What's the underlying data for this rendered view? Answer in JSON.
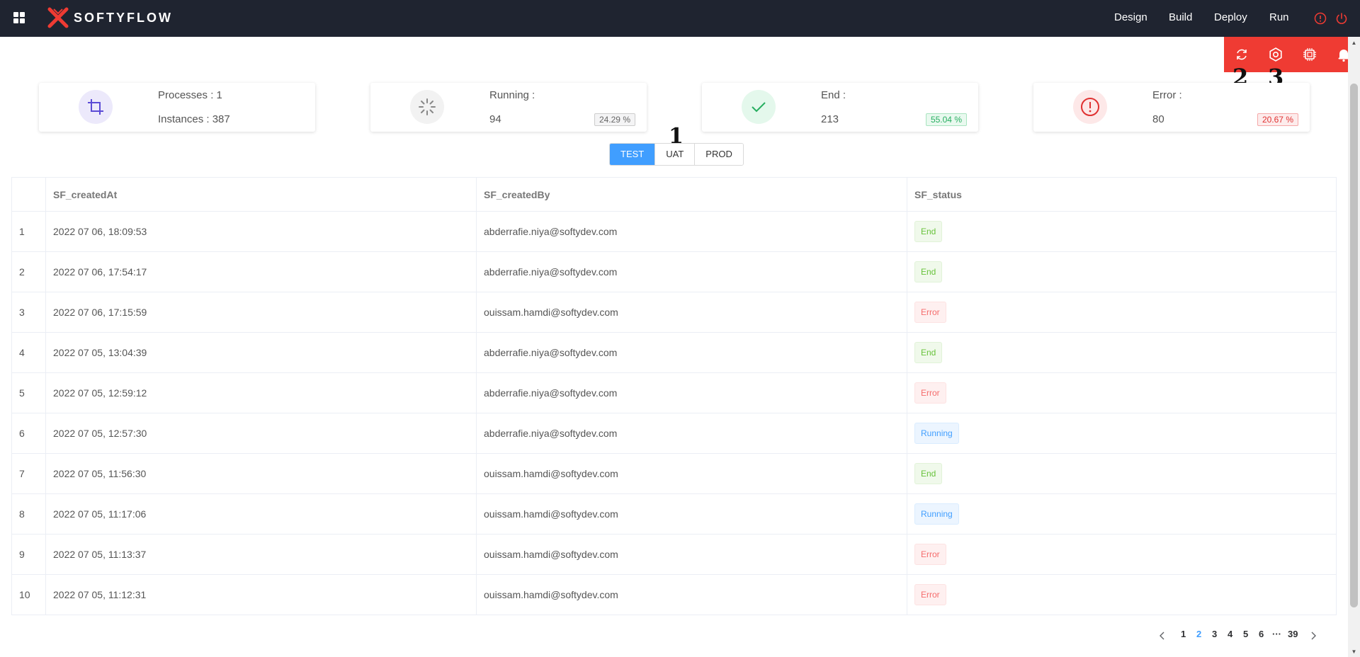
{
  "brand": {
    "name": "SOFTYFLOW",
    "accent": "#ef3b33"
  },
  "nav": {
    "items": [
      "Design",
      "Build",
      "Deploy",
      "Run"
    ]
  },
  "markers": [
    "1",
    "2",
    "3"
  ],
  "cards": {
    "processes_label": "Processes : 1",
    "instances_label": "Instances : 387",
    "running_label": "Running :",
    "running_value": "94",
    "running_pct": "24.29 %",
    "end_label": "End :",
    "end_value": "213",
    "end_pct": "55.04 %",
    "error_label": "Error :",
    "error_value": "80",
    "error_pct": "20.67 %"
  },
  "env_tabs": [
    "TEST",
    "UAT",
    "PROD"
  ],
  "table": {
    "headers": [
      "",
      "SF_createdAt",
      "SF_createdBy",
      "SF_status"
    ],
    "rows": [
      [
        "1",
        "2022 07 06, 18:09:53",
        "abderrafie.niya@softydev.com",
        "End"
      ],
      [
        "2",
        "2022 07 06, 17:54:17",
        "abderrafie.niya@softydev.com",
        "End"
      ],
      [
        "3",
        "2022 07 06, 17:15:59",
        "ouissam.hamdi@softydev.com",
        "Error"
      ],
      [
        "4",
        "2022 07 05, 13:04:39",
        "abderrafie.niya@softydev.com",
        "End"
      ],
      [
        "5",
        "2022 07 05, 12:59:12",
        "abderrafie.niya@softydev.com",
        "Error"
      ],
      [
        "6",
        "2022 07 05, 12:57:30",
        "abderrafie.niya@softydev.com",
        "Running"
      ],
      [
        "7",
        "2022 07 05, 11:56:30",
        "ouissam.hamdi@softydev.com",
        "End"
      ],
      [
        "8",
        "2022 07 05, 11:17:06",
        "ouissam.hamdi@softydev.com",
        "Running"
      ],
      [
        "9",
        "2022 07 05, 11:13:37",
        "ouissam.hamdi@softydev.com",
        "Error"
      ],
      [
        "10",
        "2022 07 05, 11:12:31",
        "ouissam.hamdi@softydev.com",
        "Error"
      ]
    ]
  },
  "pagination": {
    "pages": [
      "1",
      "2",
      "3",
      "4",
      "5",
      "6",
      "···",
      "39"
    ],
    "current": "2",
    "prev": "‹",
    "next": "›"
  }
}
